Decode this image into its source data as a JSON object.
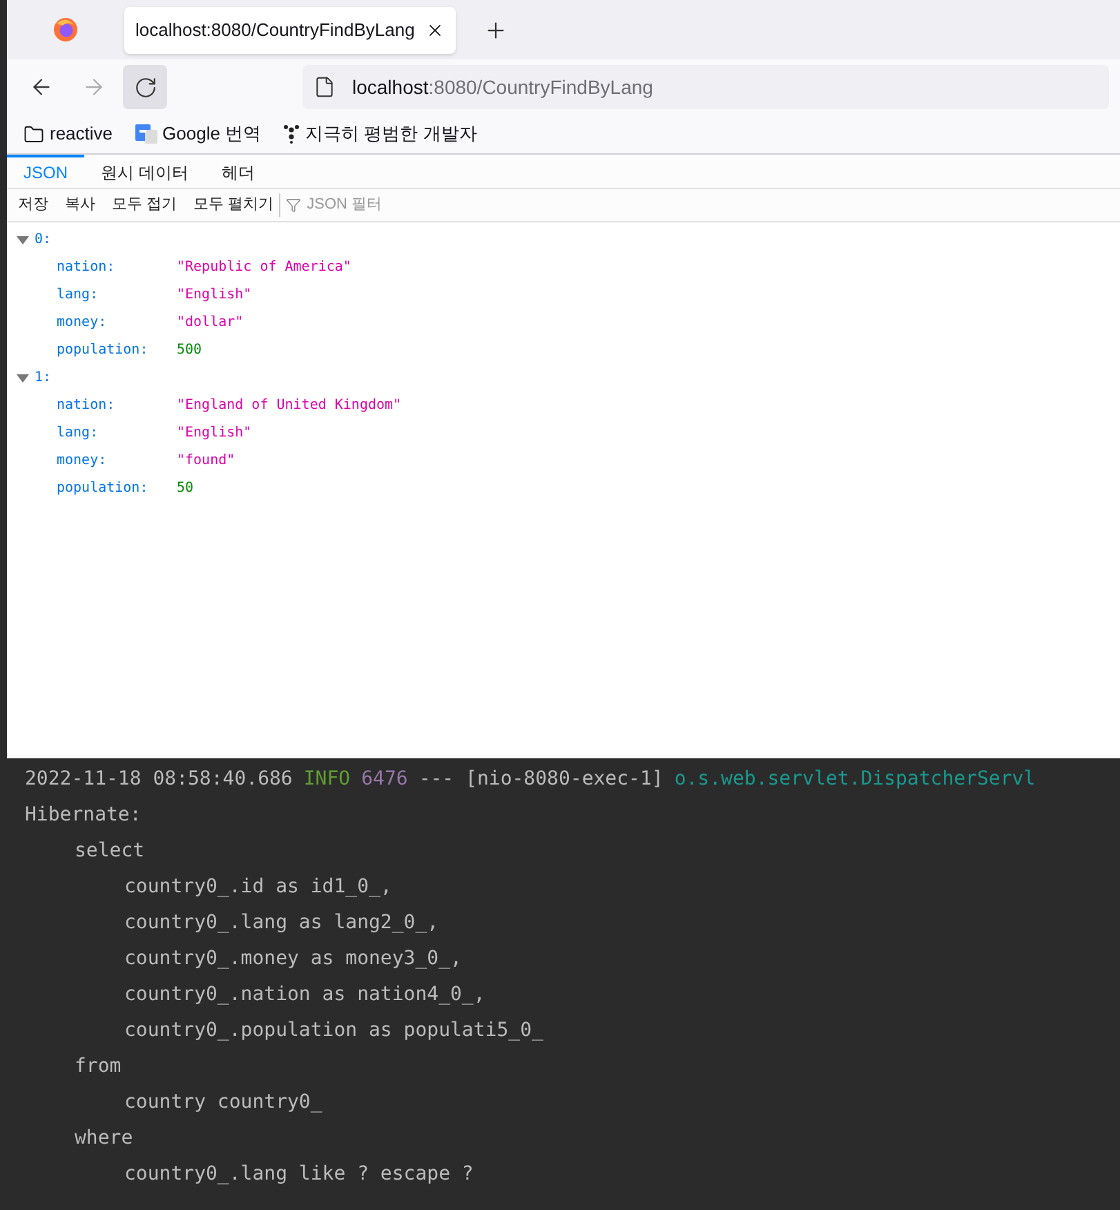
{
  "browser": {
    "tab": {
      "title": "localhost:8080/CountryFindByLang",
      "selected": true
    },
    "address": {
      "host": "localhost",
      "rest": ":8080/CountryFindByLang"
    },
    "bookmarks": [
      {
        "kind": "folder",
        "label": "reactive"
      },
      {
        "kind": "translate",
        "label": "Google 번역"
      },
      {
        "kind": "dots",
        "label": "지극히 평범한 개발자"
      }
    ]
  },
  "viewer": {
    "tabs": [
      {
        "label": "JSON",
        "selected": true
      },
      {
        "label": "원시 데이터",
        "selected": false
      },
      {
        "label": "헤더",
        "selected": false
      }
    ],
    "toolbar": [
      "저장",
      "복사",
      "모두 접기",
      "모두 펼치기"
    ],
    "filter": {
      "placeholder": "JSON 필터"
    },
    "items": [
      {
        "index": "0:",
        "expanded": true,
        "fields": [
          {
            "key": "nation:",
            "value": "\"Republic of America\"",
            "kind": "string"
          },
          {
            "key": "lang:",
            "value": "\"English\"",
            "kind": "string"
          },
          {
            "key": "money:",
            "value": "\"dollar\"",
            "kind": "string"
          },
          {
            "key": "population:",
            "value": "500",
            "kind": "number"
          }
        ]
      },
      {
        "index": "1:",
        "expanded": true,
        "fields": [
          {
            "key": "nation:",
            "value": "\"England of United Kingdom\"",
            "kind": "string"
          },
          {
            "key": "lang:",
            "value": "\"English\"",
            "kind": "string"
          },
          {
            "key": "money:",
            "value": "\"found\"",
            "kind": "string"
          },
          {
            "key": "population:",
            "value": "50",
            "kind": "number"
          }
        ]
      }
    ]
  },
  "console": {
    "log_line": [
      {
        "text": "2022-11-18 08:58:40.686",
        "color": "#bbbbbb"
      },
      {
        "text": "INFO",
        "color": "#5f9e33"
      },
      {
        "text": "6476",
        "color": "#9876aa"
      },
      {
        "text": "--- [nio-8080-exec-1]",
        "color": "#bbbbbb"
      },
      {
        "text": "o.s.web.servlet.DispatcherServl",
        "color": "#19998f"
      }
    ],
    "lines": [
      {
        "text": "Hibernate:",
        "children": [
          {
            "text": "select",
            "children": [
              {
                "text": "country0_.id as id1_0_,"
              },
              {
                "text": "country0_.lang as lang2_0_,"
              },
              {
                "text": "country0_.money as money3_0_,"
              },
              {
                "text": "country0_.nation as nation4_0_,"
              },
              {
                "text": "country0_.population as populati5_0_"
              }
            ]
          },
          {
            "text": "from",
            "children": [
              {
                "text": "country country0_"
              }
            ]
          },
          {
            "text": "where",
            "children": [
              {
                "text": "country0_.lang like ? escape ?"
              }
            ]
          }
        ]
      }
    ]
  }
}
